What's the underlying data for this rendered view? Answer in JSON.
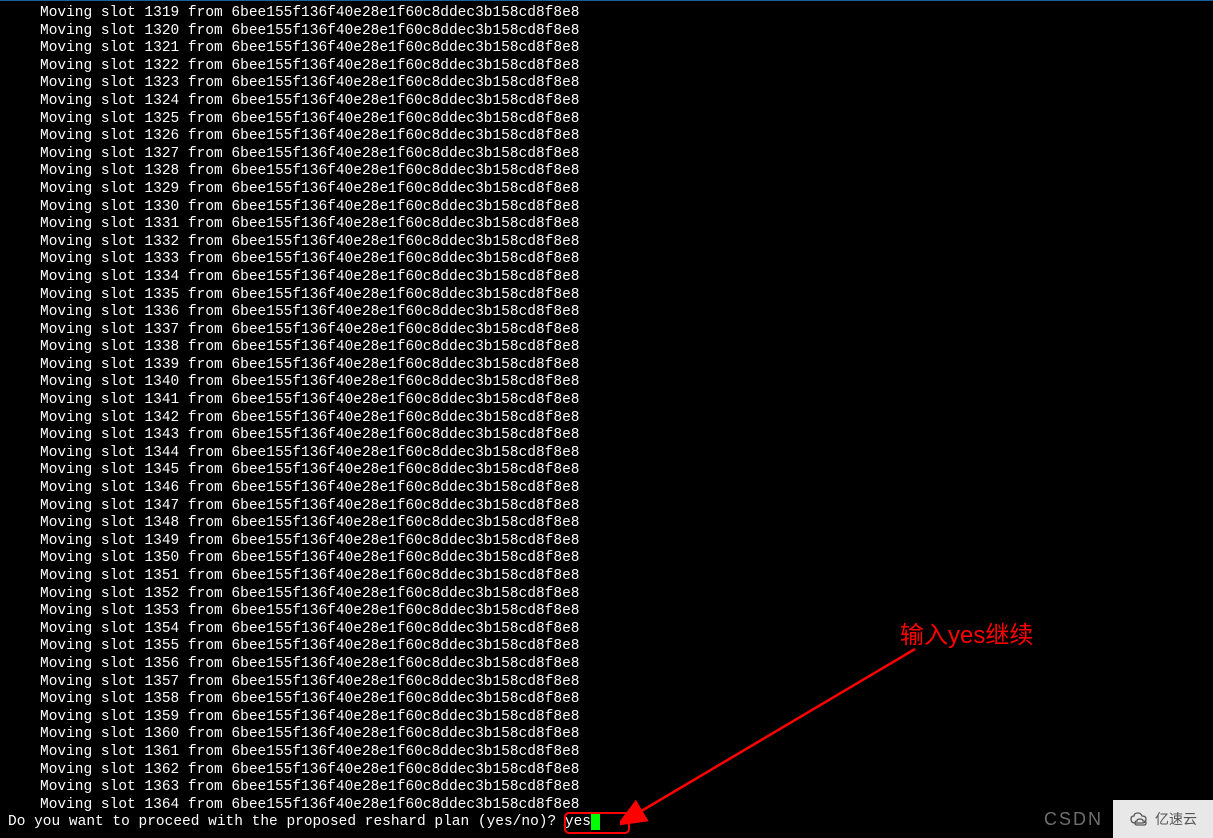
{
  "terminal": {
    "node_hash": "6bee155f136f40e28e1f60c8ddec3b158cd8f8e8",
    "slot_start": 1319,
    "slot_end": 1364,
    "line_prefix": "Moving slot ",
    "line_middle": " from ",
    "prompt": "Do you want to proceed with the proposed reshard plan (yes/no)? ",
    "input_value": "yes"
  },
  "annotation": {
    "text": "输入yes继续",
    "color": "#ff0000"
  },
  "watermarks": {
    "csdn": "CSDN",
    "yisu": "亿速云"
  }
}
